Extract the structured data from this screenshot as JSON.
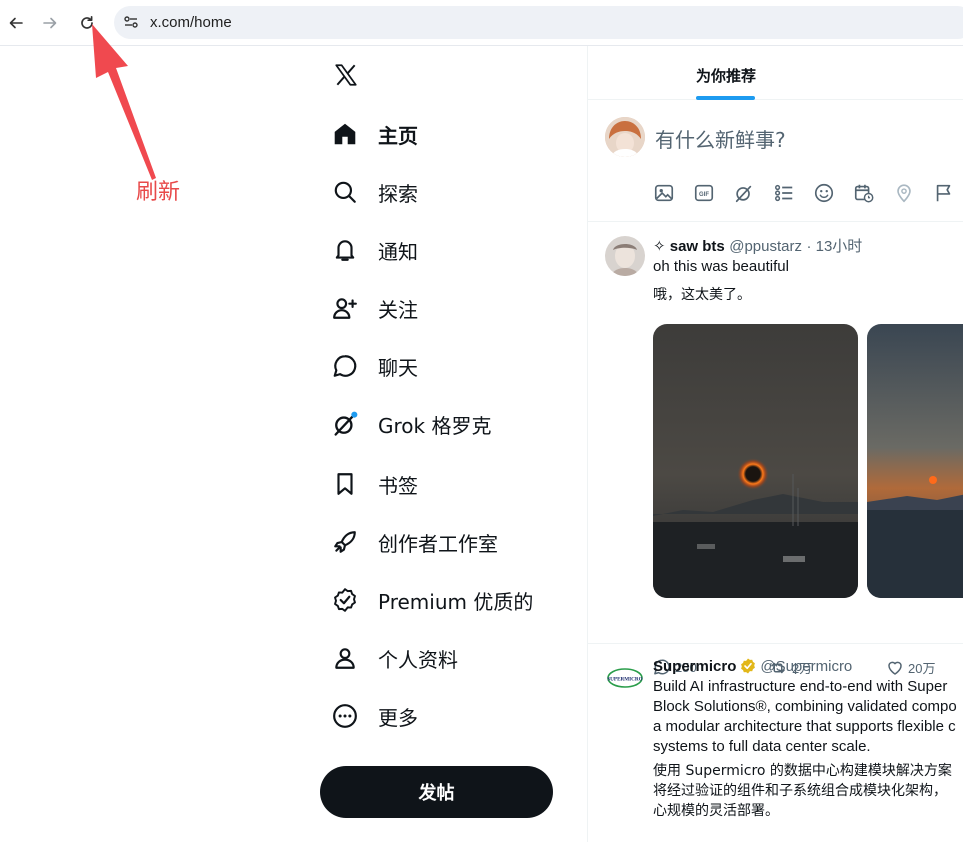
{
  "browser": {
    "url": "x.com/home"
  },
  "annotation": {
    "label": "刷新",
    "color": "#e84a4a"
  },
  "sidebar": {
    "items": [
      {
        "label": "主页",
        "icon": "home-icon"
      },
      {
        "label": "探索",
        "icon": "search-icon"
      },
      {
        "label": "通知",
        "icon": "bell-icon"
      },
      {
        "label": "关注",
        "icon": "follow-icon"
      },
      {
        "label": "聊天",
        "icon": "chat-icon"
      },
      {
        "label": "Grok  格罗克",
        "icon": "grok-icon"
      },
      {
        "label": "书签",
        "icon": "bookmark-icon"
      },
      {
        "label": "创作者工作室",
        "icon": "rocket-icon"
      },
      {
        "label": "Premium  优质的",
        "icon": "verified-icon"
      },
      {
        "label": "个人资料",
        "icon": "profile-icon"
      },
      {
        "label": "更多",
        "icon": "more-icon"
      }
    ],
    "post_label": "发帖"
  },
  "main": {
    "tab_label": "为你推荐",
    "composer_placeholder": "有什么新鲜事?",
    "tweets": [
      {
        "name": "✧ saw bts",
        "handle": "@ppustarz",
        "time": "· 13小时",
        "text": "oh this was beautiful",
        "translation": "哦，这太美了。",
        "replies": "250",
        "retweets": "2万",
        "likes": "20万"
      },
      {
        "name": "Supermicro",
        "handle": "@Supermicro",
        "avatar_text": "SUPERMICRO",
        "lines": [
          "Build AI infrastructure end-to-end with Super",
          "Block Solutions®, combining validated compo",
          "a modular architecture that supports flexible c",
          "systems to full data center scale."
        ],
        "translation_lines": [
          "使用 Supermicro 的数据中心构建模块解决方案",
          "将经过验证的组件和子系统组合成模块化架构，",
          "心规模的灵活部署。"
        ]
      }
    ]
  },
  "colors": {
    "accent": "#1d9bf0",
    "text": "#0f1419",
    "muted": "#536471"
  }
}
